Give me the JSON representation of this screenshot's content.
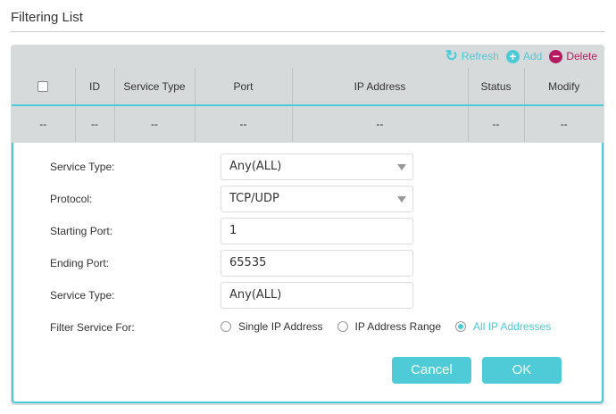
{
  "title": "Filtering List",
  "toolbar": {
    "refresh": "Refresh",
    "add": "Add",
    "delete": "Delete"
  },
  "table": {
    "headers": [
      "ID",
      "Service Type",
      "Port",
      "IP Address",
      "Status",
      "Modify"
    ],
    "row": [
      "--",
      "--",
      "--",
      "--",
      "--",
      "--",
      "--"
    ]
  },
  "form": {
    "service_type_label": "Service Type:",
    "service_type_value": "Any(ALL)",
    "protocol_label": "Protocol:",
    "protocol_value": "TCP/UDP",
    "start_port_label": "Starting Port:",
    "start_port_value": "1",
    "end_port_label": "Ending Port:",
    "end_port_value": "65535",
    "service_type2_label": "Service Type:",
    "service_type2_value": "Any(ALL)",
    "filter_label": "Filter Service For:",
    "options": [
      "Single IP Address",
      "IP Address Range",
      "All IP Addresses"
    ],
    "selected": "All IP Addresses"
  },
  "buttons": {
    "cancel": "Cancel",
    "ok": "OK"
  },
  "colors": {
    "accent": "#4acbd6",
    "delete": "#b5195f"
  }
}
